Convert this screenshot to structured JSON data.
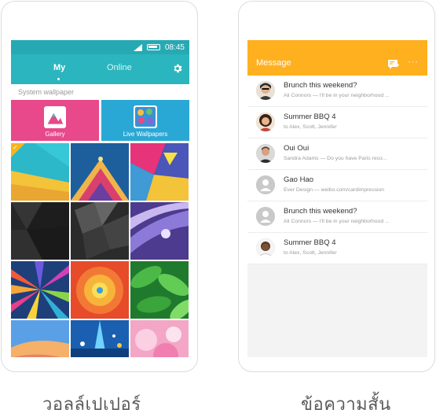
{
  "wallpaper_app": {
    "status_time": "08:45",
    "tabs": [
      {
        "label": "My"
      },
      {
        "label": "Online"
      }
    ],
    "section_label": "System wallpaper",
    "tiles": {
      "gallery": "Gallery",
      "live": "Live Wallpapers"
    }
  },
  "message_app": {
    "title": "Message",
    "more": "···",
    "messages": [
      {
        "name": "Brunch this weekend?",
        "snippet": "Ali Connors — I'll be in your neighborhood ..."
      },
      {
        "name": "Summer BBQ  4",
        "snippet": "to Alex, Scott, Jennifer"
      },
      {
        "name": "Oui Oui",
        "snippet": "Sandra Adams — Do you have Paris reco..."
      },
      {
        "name": "Gao Hao",
        "snippet": "Ever Design — weibo.com/cardimpression"
      },
      {
        "name": "Brunch this weekend?",
        "snippet": "Ali Connors — I'll be in your neighborhood ..."
      },
      {
        "name": "Summer BBQ  4",
        "snippet": "to Alex, Scott, Jennifer"
      }
    ]
  },
  "captions": {
    "left": "วอลล์เปเปอร์",
    "right": "ข้อความสั้น"
  },
  "colors": {
    "teal": "#2bb5be",
    "pink": "#e7498a",
    "blue": "#2aa8d5",
    "orange": "#ffb01f",
    "check": "#f4b51e"
  }
}
